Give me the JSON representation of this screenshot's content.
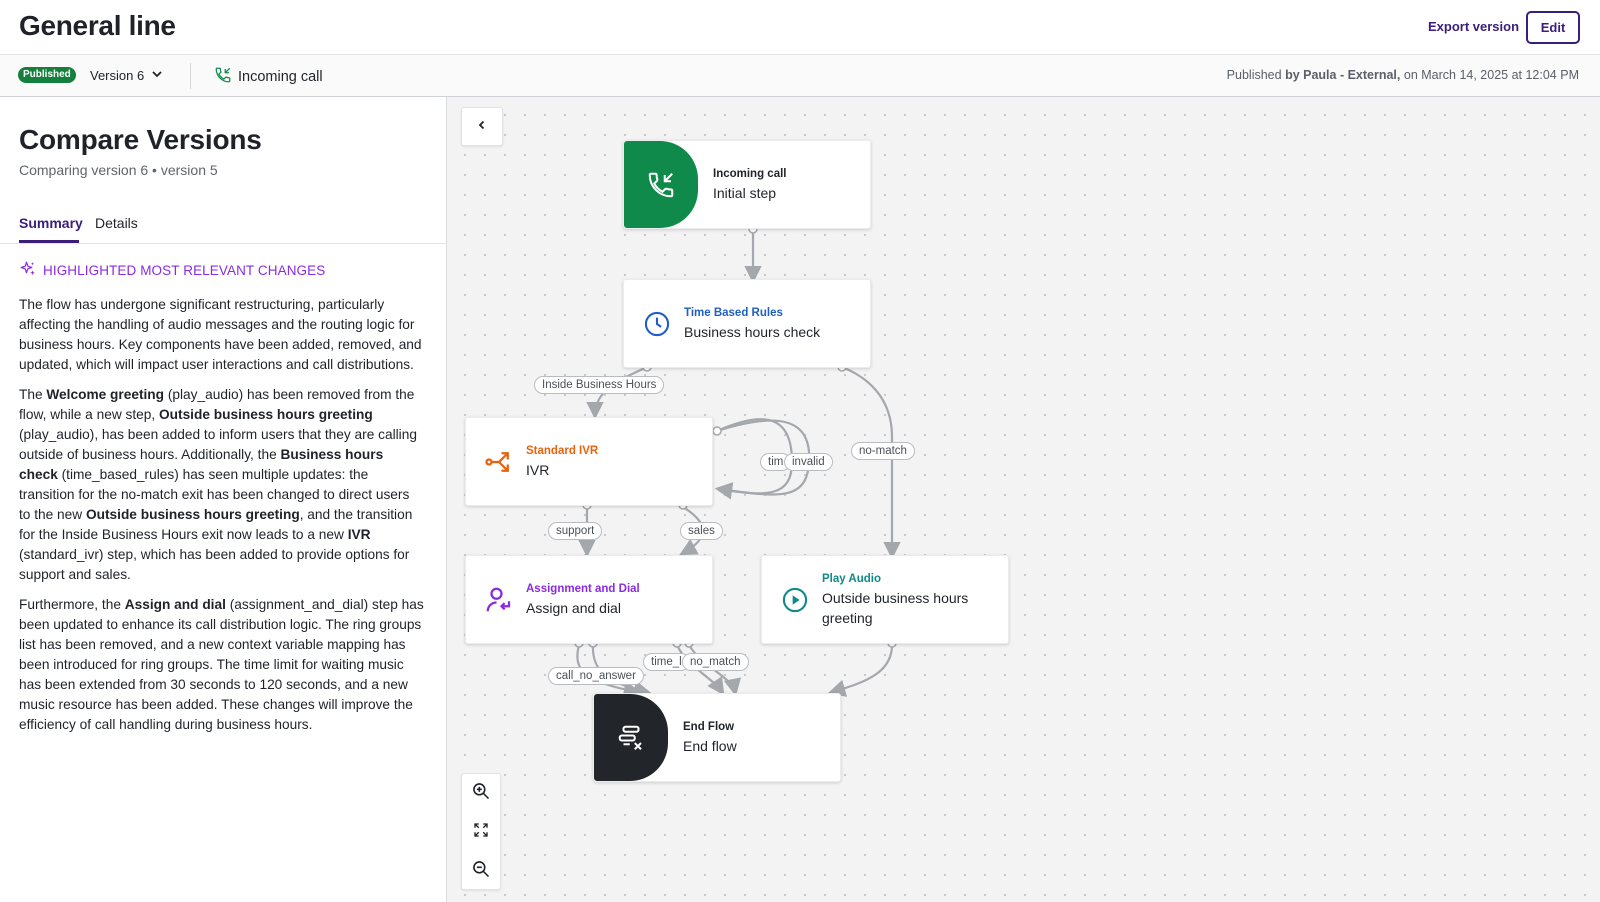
{
  "header": {
    "title": "General line",
    "export_label": "Export version",
    "edit_label": "Edit"
  },
  "subbar": {
    "status_badge": "Published",
    "version_label": "Version 6",
    "flow_type": "Incoming call",
    "publish_prefix": "Published",
    "publish_by": "by Paula - External,",
    "publish_date": "on March 14, 2025 at 12:04 PM"
  },
  "panel": {
    "title": "Compare Versions",
    "subtitle": "Comparing version 6 • version 5",
    "tabs": [
      {
        "label": "Summary",
        "active": true
      },
      {
        "label": "Details",
        "active": false
      }
    ],
    "highlight_heading": "HIGHLIGHTED MOST RELEVANT CHANGES",
    "paragraphs": [
      [
        {
          "t": "The flow has undergone significant restructuring, particularly affecting the handling of audio messages and the routing logic for business hours. Key components have been added, removed, and updated, which will impact user interactions and call distributions.",
          "b": false
        }
      ],
      [
        {
          "t": "The ",
          "b": false
        },
        {
          "t": "Welcome greeting",
          "b": true
        },
        {
          "t": " (play_audio) has been removed from the flow, while a new step, ",
          "b": false
        },
        {
          "t": "Outside business hours greeting",
          "b": true
        },
        {
          "t": " (play_audio), has been added to inform users that they are calling outside of business hours. Additionally, the ",
          "b": false
        },
        {
          "t": "Business hours check",
          "b": true
        },
        {
          "t": " (time_based_rules) has seen multiple updates: the transition for the no-match exit has been changed to direct users to the new ",
          "b": false
        },
        {
          "t": "Outside business hours greeting",
          "b": true
        },
        {
          "t": ", and the transition for the Inside Business Hours exit now leads to a new ",
          "b": false
        },
        {
          "t": "IVR",
          "b": true
        },
        {
          "t": " (standard_ivr) step, which has been added to provide options for support and sales.",
          "b": false
        }
      ],
      [
        {
          "t": "Furthermore, the ",
          "b": false
        },
        {
          "t": "Assign and dial",
          "b": true
        },
        {
          "t": " (assignment_and_dial) step has been updated to enhance its call distribution logic. The ring groups list has been removed, and a new context variable mapping has been introduced for ring groups. The time limit for waiting music has been extended from 30 seconds to 120 seconds, and a new music resource has been added. These changes will improve the efficiency of call handling during business hours.",
          "b": false
        }
      ]
    ]
  },
  "canvas": {
    "nodes": {
      "incoming": {
        "type": "Incoming call",
        "name": "Initial step",
        "icon": "phone-incoming-icon"
      },
      "time_rules": {
        "type": "Time Based Rules",
        "name": "Business hours check",
        "icon": "clock-icon"
      },
      "ivr": {
        "type": "Standard IVR",
        "name": "IVR",
        "icon": "branch-arrows-icon"
      },
      "assign": {
        "type": "Assignment and Dial",
        "name": "Assign and dial",
        "icon": "user-assign-icon"
      },
      "play_audio": {
        "type": "Play Audio",
        "name": "Outside business hours greeting",
        "icon": "play-circle-icon"
      },
      "end_flow": {
        "type": "End Flow",
        "name": "End flow",
        "icon": "end-flow-icon"
      }
    },
    "edge_labels": {
      "inside_hours": "Inside Business Hours",
      "no_match": "no-match",
      "timeout": "tim",
      "invalid": "invalid",
      "support": "support",
      "sales": "sales",
      "call_no_answer": "call_no_answer",
      "time_limit": "time_l",
      "no_match_2": "no_match"
    }
  },
  "colors": {
    "brand": "#3b1d7a",
    "published": "#15803d",
    "incoming_green": "#0f8a4b",
    "time_blue": "#1f5fc4",
    "ivr_orange": "#e8620c",
    "assign_purple": "#8a2be2",
    "audio_teal": "#0e8a8a",
    "end_dark": "#22262b"
  }
}
